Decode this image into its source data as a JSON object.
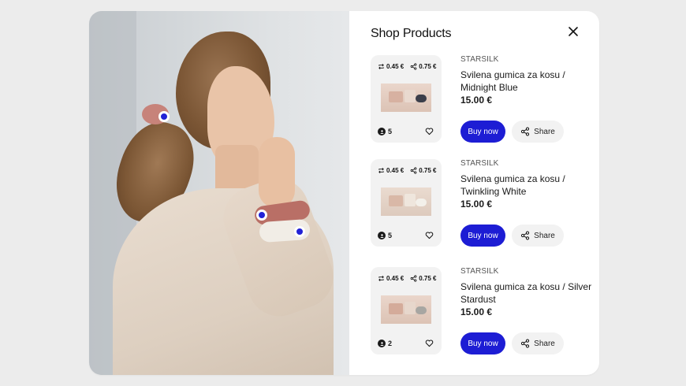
{
  "panel": {
    "title": "Shop Products"
  },
  "colors": {
    "accent": "#1d1dd4",
    "card_bg": "#f2f2f2",
    "page_bg": "#ececec"
  },
  "icons": {
    "close": "close-icon",
    "repost": "repost-icon",
    "share": "share-icon",
    "user": "user-icon",
    "heart": "heart-icon"
  },
  "products": [
    {
      "brand": "STARSILK",
      "name": "Svilena gumica za kosu / Midnight Blue",
      "price": "15.00 €",
      "repost_value": "0.45 €",
      "share_value": "0.75 €",
      "count": "5",
      "buy_label": "Buy now",
      "share_label": "Share"
    },
    {
      "brand": "STARSILK",
      "name": "Svilena gumica za kosu / Twinkling White",
      "price": "15.00 €",
      "repost_value": "0.45 €",
      "share_value": "0.75 €",
      "count": "5",
      "buy_label": "Buy now",
      "share_label": "Share"
    },
    {
      "brand": "STARSILK",
      "name": "Svilena gumica za kosu / Silver Stardust",
      "price": "15.00 €",
      "repost_value": "0.45 €",
      "share_value": "0.75 €",
      "count": "2",
      "buy_label": "Buy now",
      "share_label": "Share"
    }
  ]
}
